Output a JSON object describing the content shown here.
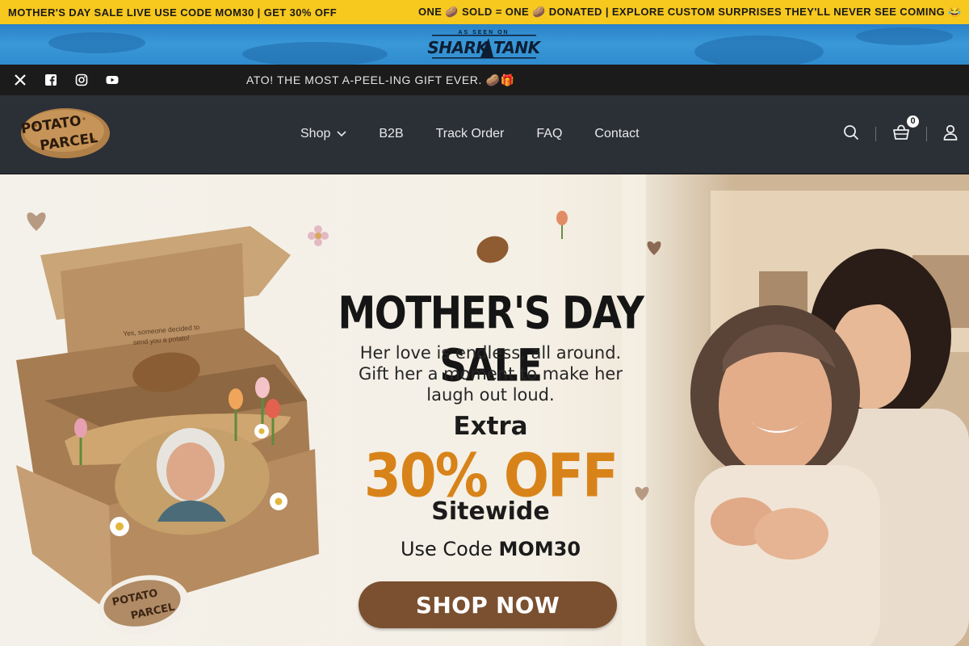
{
  "announcement": {
    "left": "MOTHER'S DAY SALE LIVE USE CODE MOM30 | GET 30% OFF",
    "right": "ONE 🥔 SOLD = ONE 🥔 DONATED | EXPLORE CUSTOM SURPRISES THEY'LL NEVER SEE COMING 😂"
  },
  "shark_tank": {
    "top": "AS SEEN ON",
    "name": "SHARK TANK"
  },
  "social": {
    "icons": [
      "x-icon",
      "facebook-icon",
      "instagram-icon",
      "youtube-icon"
    ],
    "ticker": "ATO! THE MOST A-PEEL-ING GIFT EVER. 🥔🎁"
  },
  "header": {
    "brand": {
      "line1": "POTATO",
      "line2": "PARCEL"
    },
    "nav": [
      "Shop",
      "B2B",
      "Track Order",
      "FAQ",
      "Contact"
    ],
    "cart_count": "0"
  },
  "hero": {
    "box_text_line1": "Yes, someone decided to",
    "box_text_line2": "send you a potato!",
    "title": "MOTHER'S DAY SALE",
    "subtitle_lines": [
      "Her love is endless, all around.",
      "Gift her a moment to make her",
      "laugh out loud."
    ],
    "extra": "Extra",
    "discount": "30% OFF",
    "sitewide": "Sitewide",
    "code_prefix": "Use Code ",
    "code": "MOM30",
    "cta": "SHOP NOW"
  },
  "colors": {
    "announce_bg": "#f7c81e",
    "header_bg": "#2b2f36",
    "accent_orange": "#d88319",
    "button_brown": "#7a5030"
  }
}
